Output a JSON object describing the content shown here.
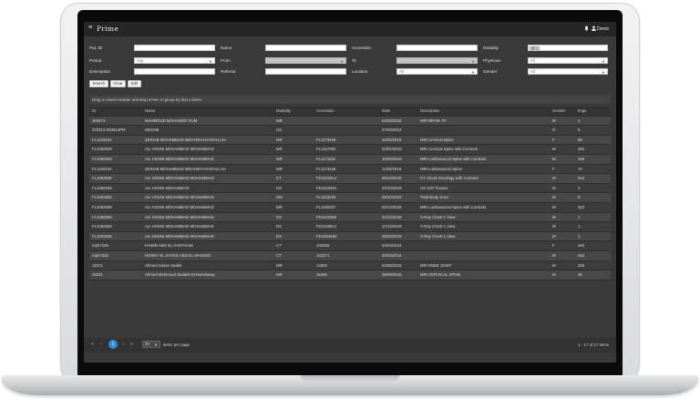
{
  "app": {
    "logo": "Prime",
    "username": "Demo"
  },
  "filters": {
    "pat_id": {
      "label": "Pat. ID",
      "value": ""
    },
    "name": {
      "label": "Name",
      "value": ""
    },
    "accession": {
      "label": "Accession",
      "value": ""
    },
    "modality": {
      "label": "Modality",
      "value": "All"
    },
    "period": {
      "label": "Period",
      "value": "Any"
    },
    "from": {
      "label": "From",
      "value": ""
    },
    "to": {
      "label": "To",
      "value": ""
    },
    "physician": {
      "label": "Physician",
      "value": "All"
    },
    "description": {
      "label": "Description",
      "value": ""
    },
    "referral": {
      "label": "Referral",
      "value": ""
    },
    "location": {
      "label": "Location",
      "value": "All"
    },
    "gender": {
      "label": "Gender",
      "value": "All"
    }
  },
  "buttons": {
    "search": "Search",
    "clear": "Clear",
    "edit": "Edit"
  },
  "group_hint": "Drag a column header and drop it here to group by that column",
  "table": {
    "headers": [
      "ID",
      "Name",
      "Modality",
      "Accession",
      "Date",
      "Description",
      "Gender",
      "Imgs"
    ],
    "rows": [
      [
        "169474",
        "MAHMOUD MOHAMED RUM",
        "MR",
        "",
        "04/03/2018",
        "MRI BRAIN XY",
        "M",
        "1"
      ],
      [
        "370313-033514PM",
        "HESAM",
        "US",
        "",
        "07/03/2012",
        "",
        "O",
        "5"
      ],
      [
        "FL1100224",
        "ZEINAB MOHAMMAD IBRAHIM KHARALLAH",
        "MR",
        "FL1173445",
        "11/03/2019",
        "MRI Cervical Spine",
        "F",
        "58"
      ],
      [
        "FL1092836",
        "ALI HOSNI MOHAMMAD MOHAMMAD",
        "MR",
        "FL1167062",
        "23/01/2019",
        "MRI Cervical Spine with Contrast",
        "M",
        "483"
      ],
      [
        "FL1092836",
        "ALI HOSNI MOHAMMAD MOHAMMAD",
        "MR",
        "FL1171162",
        "10/03/2019",
        "MRI Lumbosacral Spine with Contrast",
        "M",
        "156"
      ],
      [
        "FL1100224",
        "ZEINAB MOHAMMAD IBRAHIM KHARALLAH",
        "MR",
        "FL1173446",
        "11/03/2019",
        "MRI Lumbosacral Spine",
        "F",
        "74"
      ],
      [
        "FL1092836",
        "ALI HOSNI MOHAMMAD MOHAMMAD",
        "CT",
        "FD1102914",
        "09/10/2018",
        "CT Chest Oncology with Contrast",
        "M",
        "544"
      ],
      [
        "FL1092836",
        "ALI HOSNI MOHAMMAD",
        "US",
        "FD1163491",
        "23/10/2018",
        "US Soft Tissues",
        "M",
        "1"
      ],
      [
        "FL1092836",
        "ALI HOSNI MOHAMMAD MOHAMMAD",
        "NM",
        "FL1103230",
        "09/10/2018",
        "Total Body Scan",
        "M",
        "8"
      ],
      [
        "FL1092836",
        "ALI HOSNI MOHAMMAD MOHAMMAD",
        "MR",
        "FL1159337",
        "03/12/2018",
        "MRI Lumbosacral Spine with Contrast",
        "M",
        "323"
      ],
      [
        "FL1092836",
        "ALI HOSNI MOHAMMAD MOHAMMAD",
        "DX",
        "FD1102256",
        "22/10/2018",
        "X-Ray Chest 1 View",
        "M",
        "1"
      ],
      [
        "FL1092836",
        "ALI HOSNI MOHAMMAD MOHAMMAD",
        "DX",
        "FD1159912",
        "17/12/2018",
        "X-Ray Chest 1 View",
        "M",
        "1"
      ],
      [
        "FL1092836",
        "ALI HOSNI MOHAMMAD MOHAMMAD",
        "DX",
        "FD1054560",
        "06/03/2019",
        "X-Ray Chest 1 View",
        "M",
        "1"
      ],
      [
        "mph7225",
        "HAMIN ABO EL HADYSAM",
        "CT",
        "102506",
        "23/03/2014",
        "",
        "F",
        "493"
      ],
      [
        "mph7332",
        "HOSNY EL SAYED ABD EL MAKEED",
        "CT",
        "102271",
        "20/03/2014",
        "",
        "M",
        "462"
      ],
      [
        "11571",
        "Ahmed Adnan Sadek",
        "MR",
        "14600",
        "04/06/2015",
        "MRI KNEE JOINT",
        "M",
        "226"
      ],
      [
        "15231",
        "Ahmed Mahmoud Saddek El-Monshawy",
        "MR",
        "16466",
        "25/09/2016",
        "MRI CERVICAL SPINE",
        "M",
        "38"
      ]
    ]
  },
  "pager": {
    "first": "«",
    "prev": "‹",
    "current": "1",
    "next": "›",
    "last": "»",
    "page_size": "20",
    "page_size_label": "items per page",
    "count": "1 - 17 of 17 items"
  },
  "colors": {
    "accent": "#2d8fd4",
    "background": "#3a3a3a",
    "topbar": "#262626"
  },
  "icons": {
    "menu": "hamburger-icon",
    "bell": "bell-icon",
    "user": "user-icon",
    "dropdown": "chevron-down-icon"
  }
}
